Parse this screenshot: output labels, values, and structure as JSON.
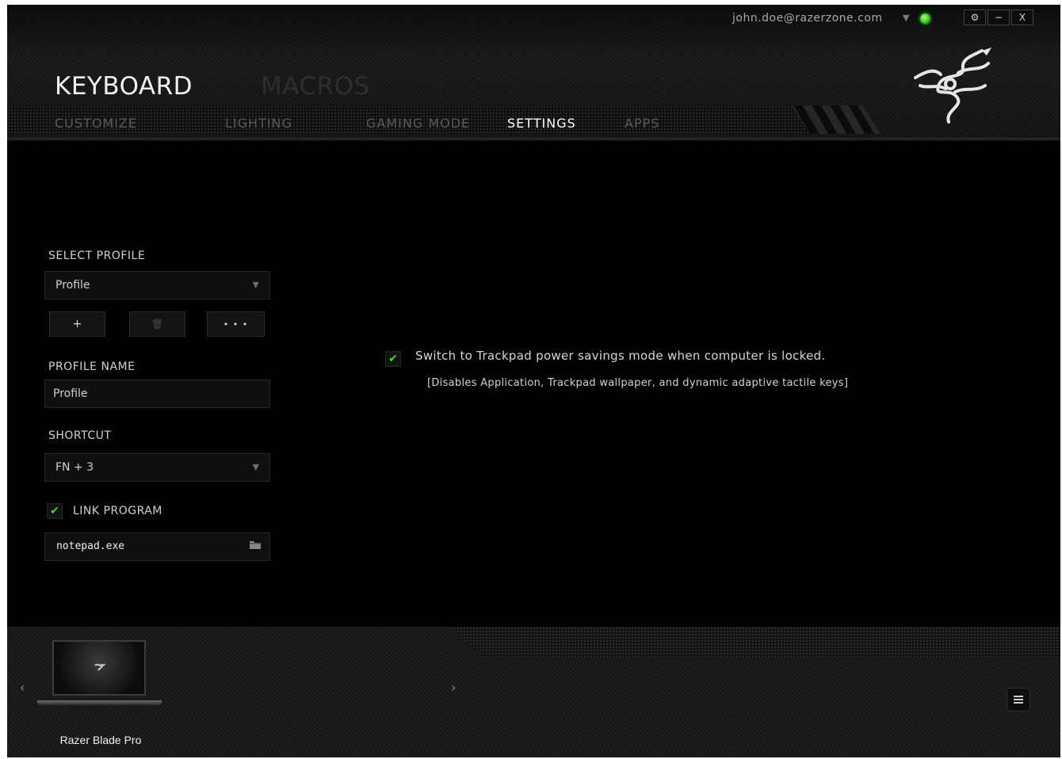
{
  "header": {
    "user_email": "john.doe@razerzone.com",
    "status_arrow": "▼",
    "titles": {
      "keyboard": "KEYBOARD",
      "macros": "MACROS"
    },
    "window_controls": {
      "settings": "⚙",
      "minimize": "−",
      "close": "X"
    }
  },
  "tabs": [
    {
      "label": "CUSTOMIZE",
      "active": false
    },
    {
      "label": "LIGHTING",
      "active": false
    },
    {
      "label": "GAMING MODE",
      "active": false
    },
    {
      "label": "SETTINGS",
      "active": true
    },
    {
      "label": "APPS",
      "active": false
    }
  ],
  "profile": {
    "select_label": "SELECT PROFILE",
    "selected": "Profile",
    "buttons": {
      "add": "+",
      "delete": "🗑",
      "more": "• • •"
    },
    "name_label": "PROFILE NAME",
    "name_value": "Profile",
    "shortcut_label": "SHORTCUT",
    "shortcut_value": "FN + 3",
    "link_program_label": "LINK PROGRAM",
    "link_program_checked": true,
    "program_value": "notepad.exe"
  },
  "settings": {
    "trackpad_power_saving": "Switch to Trackpad power savings mode when computer is locked.",
    "trackpad_note": "[Disables Application, Trackpad wallpaper, and dynamic adaptive tactile keys]",
    "trackpad_checked": true
  },
  "footer": {
    "device_name": "Razer Blade Pro",
    "prev": "‹",
    "next": "›"
  },
  "colors": {
    "accent": "#44d62c",
    "background": "#000000",
    "text": "#d2d2d2"
  }
}
